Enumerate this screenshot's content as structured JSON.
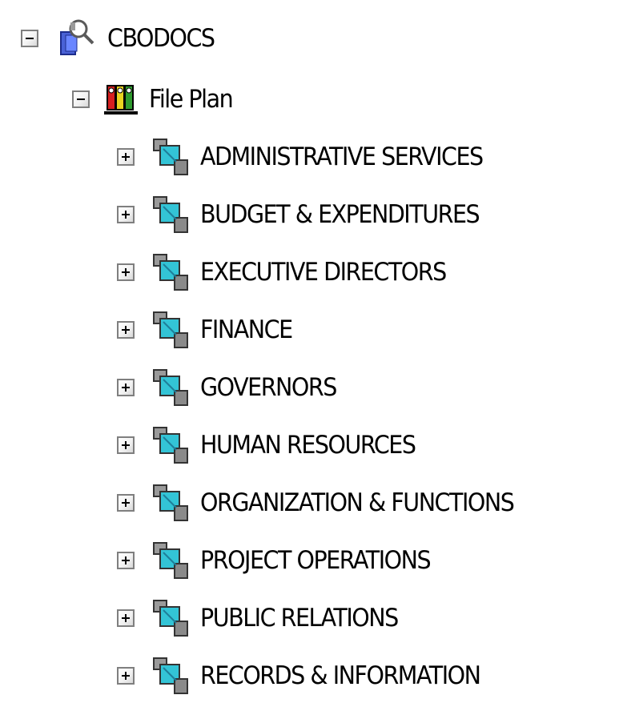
{
  "tree": {
    "root": {
      "label": "CBODOCS",
      "icon": "repository-search-icon",
      "expanded": true
    },
    "file_plan": {
      "label": "File Plan",
      "icon": "file-plan-binders-icon",
      "expanded": true
    },
    "categories": [
      {
        "label": "ADMINISTRATIVE SERVICES",
        "icon": "category-icon",
        "expanded": false
      },
      {
        "label": "BUDGET & EXPENDITURES",
        "icon": "category-icon",
        "expanded": false
      },
      {
        "label": "EXECUTIVE DIRECTORS",
        "icon": "category-icon",
        "expanded": false
      },
      {
        "label": "FINANCE",
        "icon": "category-icon",
        "expanded": false
      },
      {
        "label": "GOVERNORS",
        "icon": "category-icon",
        "expanded": false
      },
      {
        "label": "HUMAN RESOURCES",
        "icon": "category-icon",
        "expanded": false
      },
      {
        "label": "ORGANIZATION & FUNCTIONS",
        "icon": "category-icon",
        "expanded": false
      },
      {
        "label": "PROJECT OPERATIONS",
        "icon": "category-icon",
        "expanded": false
      },
      {
        "label": "PUBLIC RELATIONS",
        "icon": "category-icon",
        "expanded": false
      },
      {
        "label": "RECORDS & INFORMATION",
        "icon": "category-icon",
        "expanded": false
      }
    ]
  },
  "colors": {
    "toggle_border": "#7f7f7f",
    "category_cyan": "#33c4d6",
    "category_gray": "#8a8a8a"
  }
}
